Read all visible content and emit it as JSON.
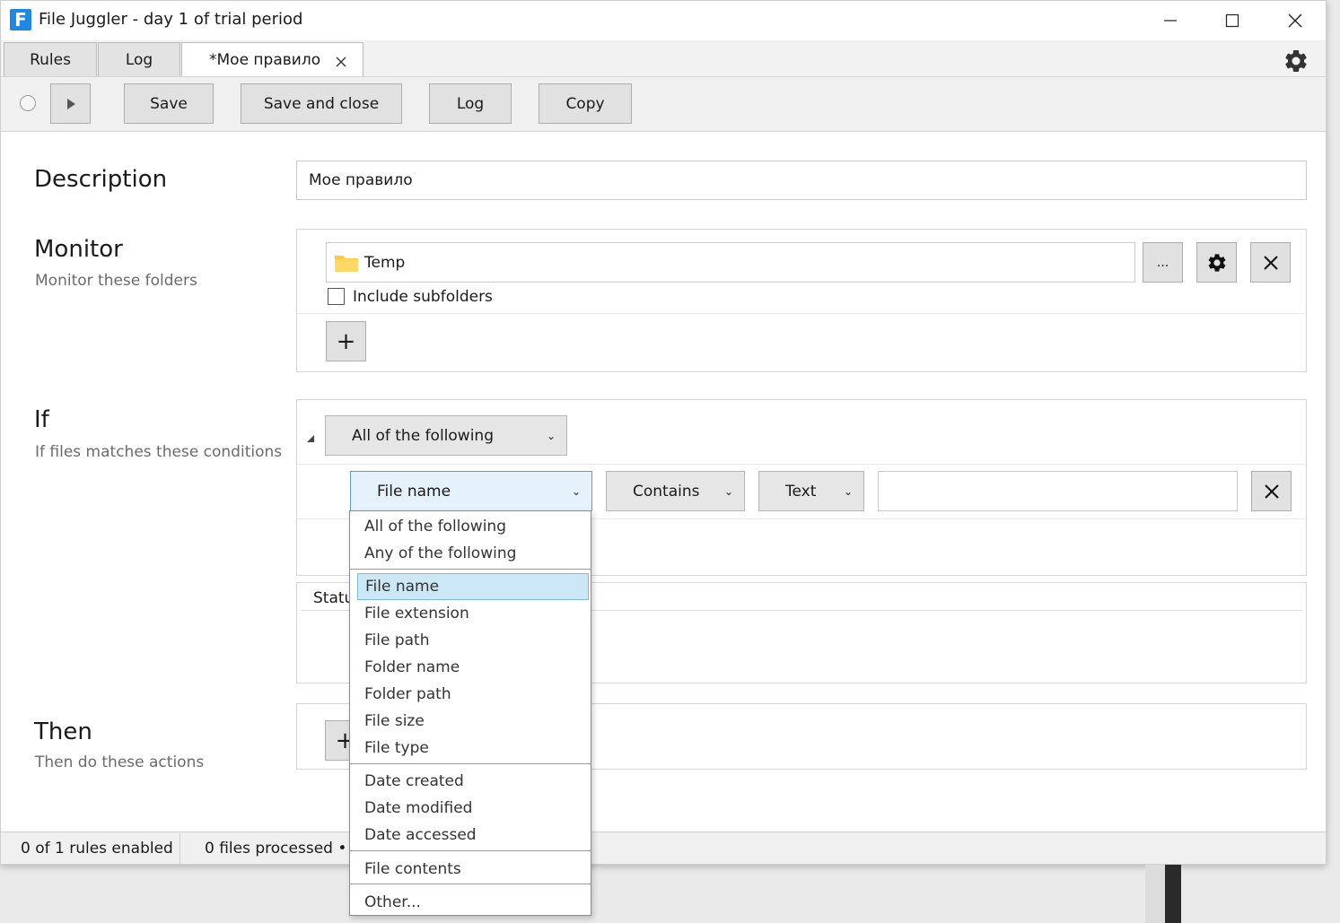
{
  "window": {
    "title": "File Juggler - day 1 of trial period",
    "app_icon_letter": "F"
  },
  "tabs": [
    {
      "label": "Rules"
    },
    {
      "label": "Log"
    },
    {
      "label": "*Мое правило"
    }
  ],
  "toolbar": {
    "save": "Save",
    "save_and_close": "Save and close",
    "log": "Log",
    "copy": "Copy"
  },
  "description": {
    "title": "Description",
    "value": "Мое правило"
  },
  "monitor": {
    "title": "Monitor",
    "subtitle": "Monitor these folders",
    "folder": "Temp",
    "browse": "...",
    "include_subfolders": "Include subfolders",
    "add": "+"
  },
  "if_section": {
    "title": "If",
    "subtitle": "If files matches these conditions",
    "group_mode": "All of the following",
    "condition": {
      "field": "File name",
      "operator": "Contains",
      "type": "Text",
      "value": ""
    },
    "status_header": "Statu"
  },
  "then_section": {
    "title": "Then",
    "subtitle": "Then do these actions",
    "add": "+"
  },
  "statusbar": {
    "rules": "0 of 1 rules enabled",
    "files": "0 files processed • 0"
  },
  "dropdown": {
    "groups": [
      [
        "All of the following",
        "Any of the following"
      ],
      [
        "File name",
        "File extension",
        "File path",
        "Folder name",
        "Folder path",
        "File size",
        "File type"
      ],
      [
        "Date created",
        "Date modified",
        "Date accessed"
      ],
      [
        "File contents"
      ],
      [
        "Other..."
      ]
    ],
    "selected": "File name"
  },
  "colors": {
    "accent": "#1e88e5",
    "selected_bg": "#cce8f7",
    "folder": "#ffc83d"
  }
}
